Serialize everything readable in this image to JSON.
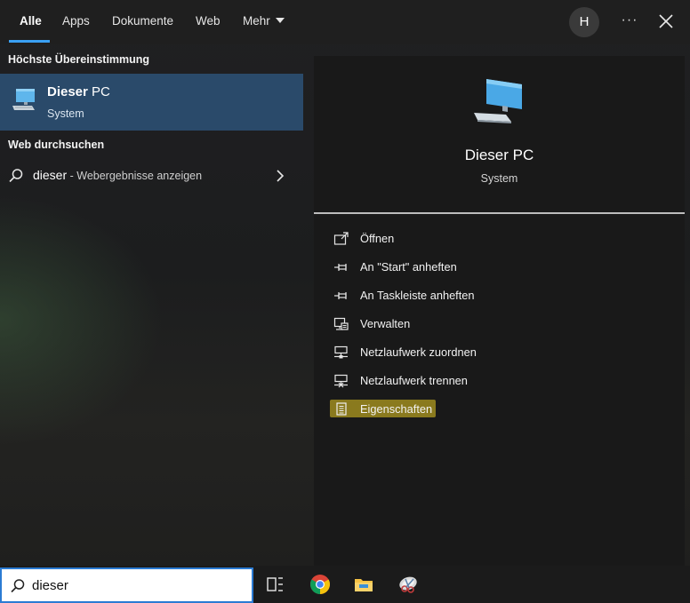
{
  "tabs": [
    {
      "label": "Alle",
      "active": true
    },
    {
      "label": "Apps"
    },
    {
      "label": "Dokumente"
    },
    {
      "label": "Web"
    },
    {
      "label": "Mehr"
    }
  ],
  "account": {
    "initial": "H"
  },
  "more_options": "···",
  "best_match": {
    "heading": "Höchste Übereinstimmung",
    "title_bold": "Dieser",
    "title_rest": " PC",
    "subtitle": "System",
    "icon": "computer-icon"
  },
  "web_search": {
    "heading": "Web durchsuchen",
    "query": "dieser",
    "suffix": " - Webergebnisse anzeigen"
  },
  "preview": {
    "title": "Dieser PC",
    "subtitle": "System",
    "actions": [
      {
        "label": "Öffnen",
        "icon": "open-icon"
      },
      {
        "label": "An \"Start\" anheften",
        "icon": "pin-icon"
      },
      {
        "label": "An Taskleiste anheften",
        "icon": "pin-icon"
      },
      {
        "label": "Verwalten",
        "icon": "manage-icon"
      },
      {
        "label": "Netzlaufwerk zuordnen",
        "icon": "network-drive-icon"
      },
      {
        "label": "Netzlaufwerk trennen",
        "icon": "network-drive-icon"
      },
      {
        "label": "Eigenschaften",
        "icon": "properties-icon",
        "highlighted": true
      }
    ]
  },
  "search_box": {
    "value": "dieser"
  },
  "colors": {
    "accent": "#3aa0f3",
    "selection": "#2a4a6a",
    "highlight": "#8a7a1e"
  }
}
